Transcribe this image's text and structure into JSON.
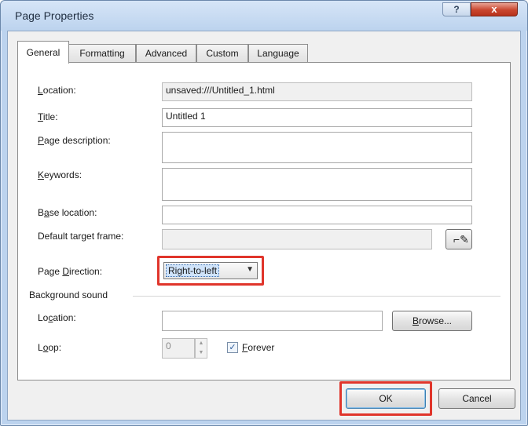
{
  "window": {
    "title": "Page Properties",
    "help_label": "?",
    "close_label": "x"
  },
  "tabs": [
    {
      "label": "General",
      "active": true
    },
    {
      "label": "Formatting",
      "active": false
    },
    {
      "label": "Advanced",
      "active": false
    },
    {
      "label": "Custom",
      "active": false
    },
    {
      "label": "Language",
      "active": false
    }
  ],
  "general": {
    "location": {
      "label_first": "L",
      "label_rest": "ocation:",
      "value": "unsaved:///Untitled_1.html"
    },
    "title": {
      "label_first": "T",
      "label_rest": "itle:",
      "value": "Untitled 1"
    },
    "page_description": {
      "label_first": "P",
      "label_rest": "age description:",
      "value": ""
    },
    "keywords": {
      "label_first": "K",
      "label_rest": "eywords:",
      "value": ""
    },
    "base_location": {
      "label_pre": "B",
      "label_ul": "a",
      "label_rest": "se location:",
      "value": ""
    },
    "default_target_frame": {
      "label": "Default target frame:",
      "value": "",
      "picker_icon": "edit-pencil-icon",
      "picker_glyph": "⌐✎"
    },
    "page_direction": {
      "label_pre": "Page ",
      "label_ul": "D",
      "label_rest": "irection:",
      "value": "Right-to-left",
      "arrow": "▼"
    }
  },
  "background_sound": {
    "group_label": "Background sound",
    "location": {
      "label_pre": "Lo",
      "label_ul": "c",
      "label_rest": "ation:",
      "value": ""
    },
    "browse_label_first": "B",
    "browse_label_rest": "rowse...",
    "loop": {
      "label_pre": "L",
      "label_ul": "o",
      "label_rest": "op:",
      "value": "0"
    },
    "forever": {
      "label_first": "F",
      "label_rest": "orever",
      "checked": true,
      "check_glyph": "✓"
    }
  },
  "buttons": {
    "ok": "OK",
    "cancel": "Cancel"
  },
  "colors": {
    "highlight": "#e0352b",
    "title_bar": "#bcd3ee"
  }
}
